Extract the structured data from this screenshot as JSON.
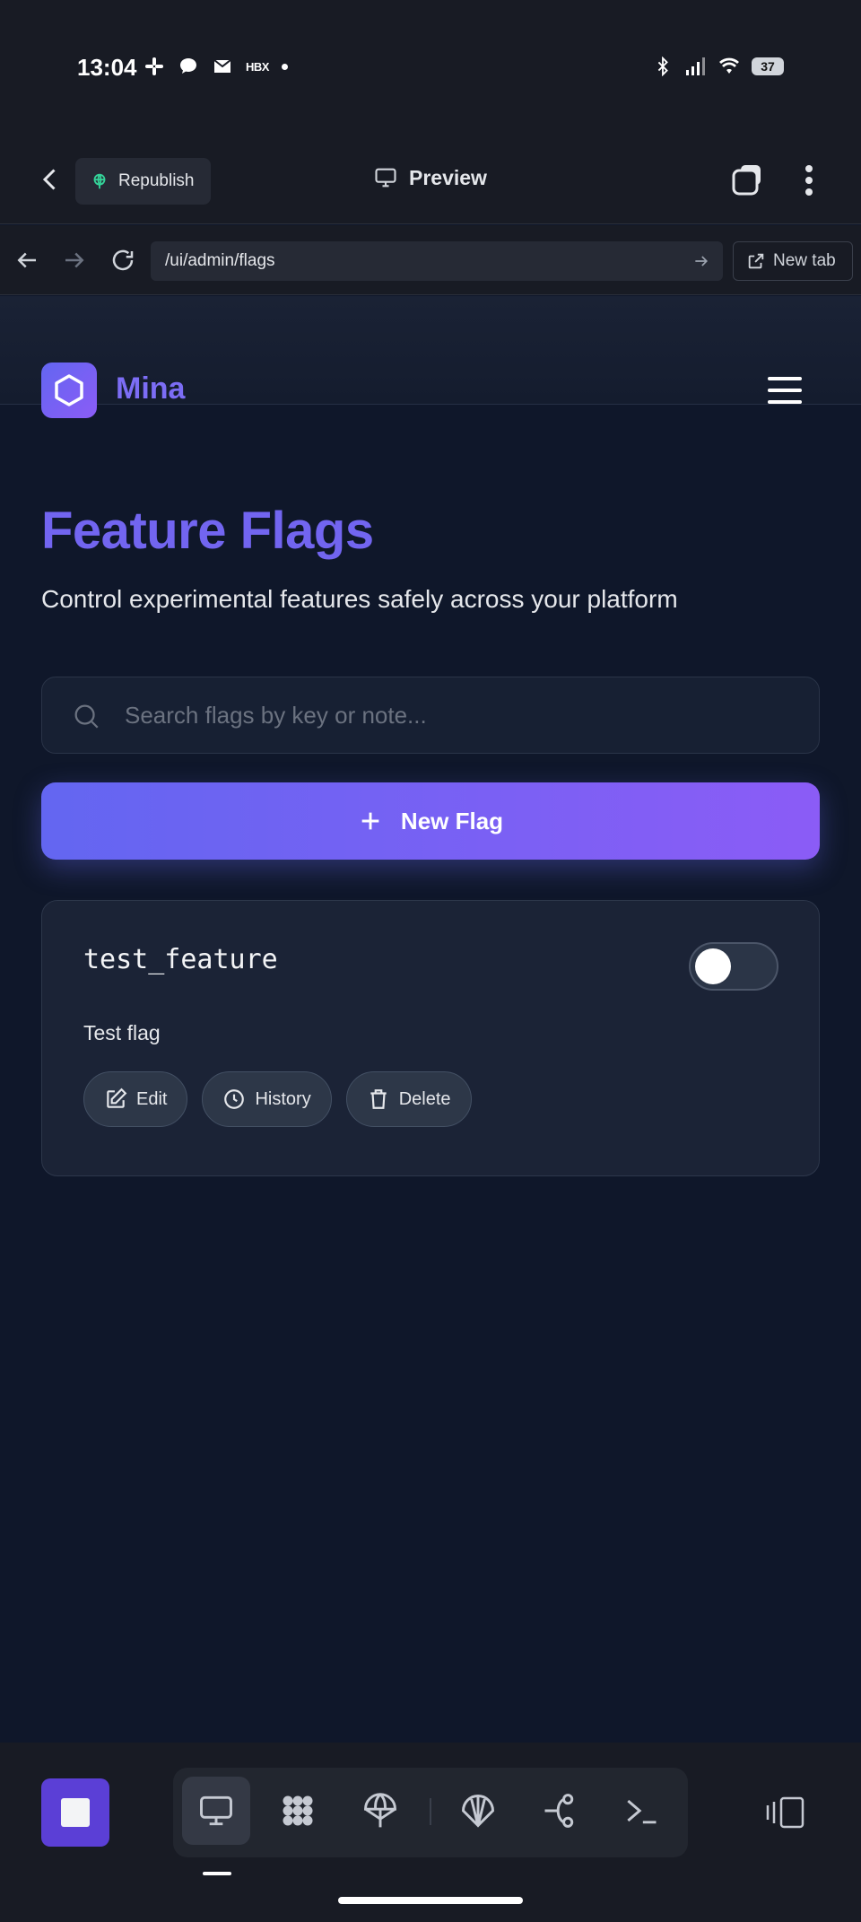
{
  "status_bar": {
    "time": "13:04",
    "notification_text": "HBX",
    "battery": "37",
    "icons": [
      "slack-icon",
      "chat-icon",
      "mail-icon",
      "bluetooth-icon",
      "signal-icon",
      "wifi-icon"
    ]
  },
  "app_header": {
    "republish_label": "Republish",
    "preview_label": "Preview"
  },
  "browser": {
    "url": "/ui/admin/flags",
    "new_tab_label": "New tab"
  },
  "site": {
    "brand": "Mina"
  },
  "page": {
    "title": "Feature Flags",
    "subtitle": "Control experimental features safely across your platform",
    "search_placeholder": "Search flags by key or note...",
    "search_value": "",
    "new_flag_label": "New Flag"
  },
  "flags": [
    {
      "key": "test_feature",
      "note": "Test flag",
      "enabled": false,
      "actions": {
        "edit": "Edit",
        "history": "History",
        "delete": "Delete"
      }
    }
  ],
  "colors": {
    "accent": "#6366f1",
    "accent_end": "#8b5cf6",
    "background": "#0f172a",
    "card": "#1b2336"
  }
}
